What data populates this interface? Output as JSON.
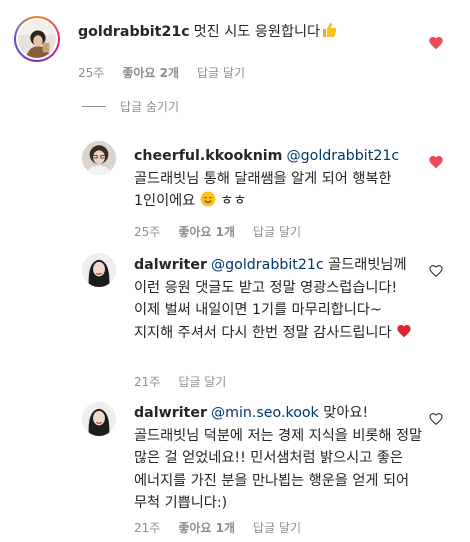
{
  "comments": [
    {
      "username": "goldrabbit21c",
      "text": "멋진 시도 응원합니다",
      "emoji": "👍",
      "time": "25주",
      "likes": "좋아요 2개",
      "reply": "답글 달기",
      "liked": true
    }
  ],
  "hide_replies_label": "답글 숨기기",
  "replies": [
    {
      "username": "cheerful.kkooknim",
      "mention": "@goldrabbit21c",
      "text": " 골드래빗님 통해 달래쌤을 알게 되어 행복한 1인이에요 ",
      "tail": " ㅎㅎ",
      "time": "25주",
      "likes": "좋아요 1개",
      "reply": "답글 달기",
      "liked": true
    },
    {
      "username": "dalwriter",
      "mention": "@goldrabbit21c",
      "text": " 골드래빗님께 이런 응원 댓글도 받고 정말 영광스럽습니다! 이제 벌써 내일이면 1기를 마무리합니다~ 지지해 주셔서 다시 한번 정말 감사드립니다 ",
      "time": "21주",
      "reply": "답글 달기",
      "liked": false
    },
    {
      "username": "dalwriter",
      "mention": "@min.seo.kook",
      "text": " 맞아요! 골드래빗님 덕분에 저는 경제 지식을 비롯해 정말 많은 걸 얻었네요!! 민서샘처럼 밝으시고 좋은 에너지를 가진 분을 만나뵙는 행운을 얻게 되어 무척 기쁩니다:)",
      "time": "21주",
      "likes": "좋아요 1개",
      "reply": "답글 달기",
      "liked": false
    }
  ],
  "colors": {
    "liked_heart": "#ed4956",
    "mention": "#00376b",
    "meta": "#8e8e8e"
  }
}
